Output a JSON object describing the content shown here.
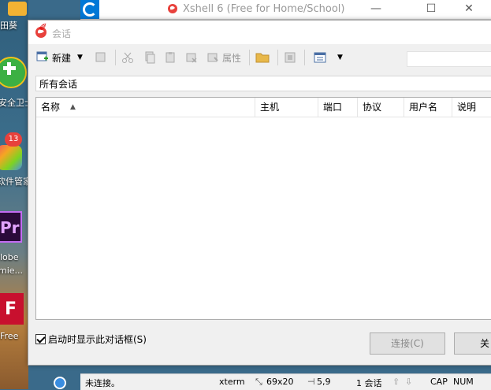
{
  "desktop": {
    "labels": [
      "田葵",
      "安全卫士",
      "软件管家",
      "lobe",
      "mie...",
      "Free"
    ],
    "badge": "13",
    "pr_text": "Pr",
    "pdf_text": "F"
  },
  "background_window": {
    "title": "Xshell 6 (Free for Home/School)",
    "minimize": "—",
    "maximize": "☐",
    "close": "✕"
  },
  "status_bar": {
    "connection": "未连接。",
    "terminal": "xterm",
    "size": "69x20",
    "cursor": "5,9",
    "sessions": "1 会话",
    "caps": "CAP",
    "num": "NUM"
  },
  "dialog": {
    "title": "会话",
    "toolbar": {
      "new_label": "新建",
      "properties_label": "属性"
    },
    "search": {
      "value": "",
      "placeholder": ""
    },
    "path": "所有会话",
    "columns": [
      "名称",
      "主机",
      "端口",
      "协议",
      "用户名",
      "说明"
    ],
    "rows": [],
    "startup_checkbox_label": "启动时显示此对话框(S)",
    "connect_button": "连接(C)",
    "close_button": "关"
  },
  "colors": {
    "xshell_red": "#e8413c",
    "accent_blue": "#0078d7"
  }
}
